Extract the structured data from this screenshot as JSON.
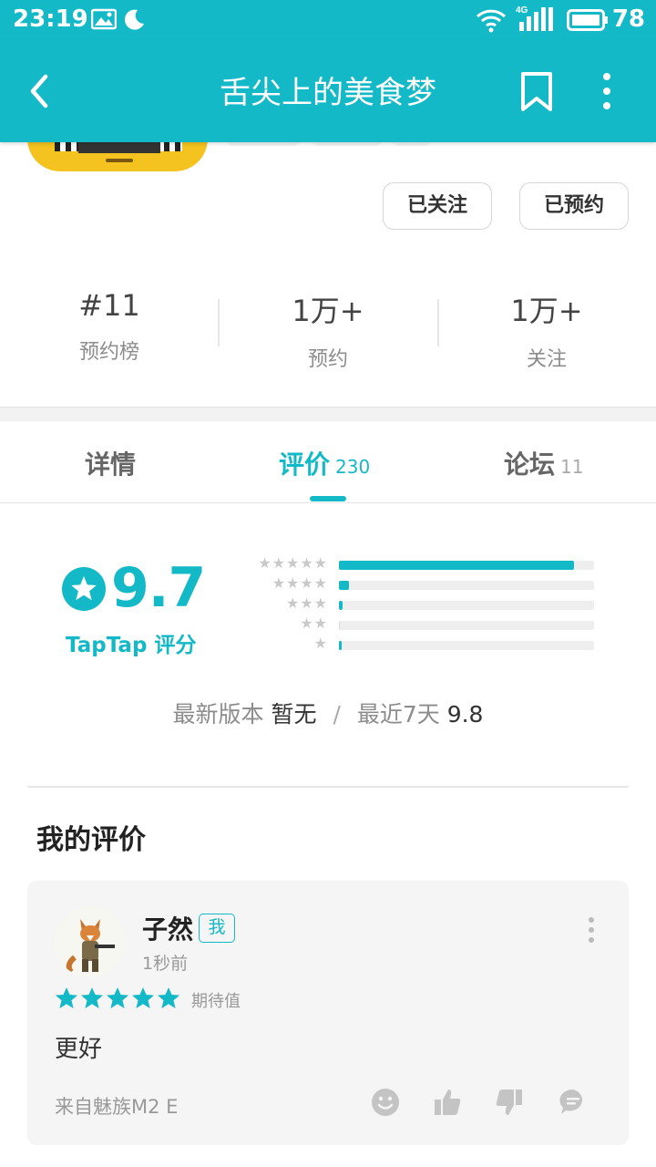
{
  "status_bar": {
    "time": "23:19",
    "network": "4G",
    "battery": "78",
    "icons": [
      "image-icon",
      "moon-icon",
      "wifi-icon",
      "signal-icon",
      "battery-icon"
    ]
  },
  "toolbar": {
    "title": "舌尖上的美食梦",
    "icons": [
      "back-arrow-icon",
      "bookmark-icon",
      "more-vertical-icon"
    ]
  },
  "actions": {
    "follow_label": "已关注",
    "reserve_label": "已预约"
  },
  "stats": [
    {
      "value": "#11",
      "label": "预约榜"
    },
    {
      "value": "1万+",
      "label": "预约"
    },
    {
      "value": "1万+",
      "label": "关注"
    }
  ],
  "tabs": [
    {
      "label": "详情",
      "count": ""
    },
    {
      "label": "评价",
      "count": "230"
    },
    {
      "label": "论坛",
      "count": "11"
    }
  ],
  "rating": {
    "score": "9.7",
    "brand": "TapTap 评分",
    "distribution": [
      {
        "stars": 5,
        "fraction": 0.92
      },
      {
        "stars": 4,
        "fraction": 0.04
      },
      {
        "stars": 3,
        "fraction": 0.015
      },
      {
        "stars": 2,
        "fraction": 0.0
      },
      {
        "stars": 1,
        "fraction": 0.012
      }
    ],
    "latest_version_label": "最新版本",
    "latest_version_value": "暂无",
    "separator": "/",
    "recent_label": "最近7天",
    "recent_value": "9.8"
  },
  "my_review": {
    "section_title": "我的评价",
    "name": "子然",
    "badge": "我",
    "time": "1秒前",
    "stars": 5,
    "tag": "期待值",
    "text": "更好",
    "source": "来自魅族M2 E",
    "action_icons": [
      "smiley-icon",
      "thumbs-up-icon",
      "thumbs-down-icon",
      "comment-icon"
    ]
  },
  "colors": {
    "accent": "#14b9c8",
    "app_icon": "#f5c320"
  }
}
